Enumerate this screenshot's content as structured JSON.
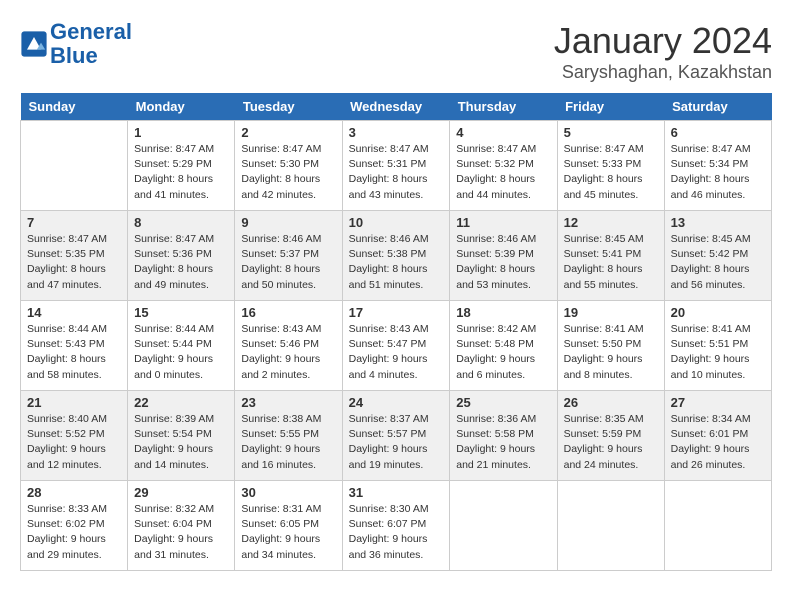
{
  "header": {
    "logo_line1": "General",
    "logo_line2": "Blue",
    "month": "January 2024",
    "location": "Saryshaghan, Kazakhstan"
  },
  "weekdays": [
    "Sunday",
    "Monday",
    "Tuesday",
    "Wednesday",
    "Thursday",
    "Friday",
    "Saturday"
  ],
  "weeks": [
    [
      {
        "day": "",
        "sunrise": "",
        "sunset": "",
        "daylight": ""
      },
      {
        "day": "1",
        "sunrise": "Sunrise: 8:47 AM",
        "sunset": "Sunset: 5:29 PM",
        "daylight": "Daylight: 8 hours and 41 minutes."
      },
      {
        "day": "2",
        "sunrise": "Sunrise: 8:47 AM",
        "sunset": "Sunset: 5:30 PM",
        "daylight": "Daylight: 8 hours and 42 minutes."
      },
      {
        "day": "3",
        "sunrise": "Sunrise: 8:47 AM",
        "sunset": "Sunset: 5:31 PM",
        "daylight": "Daylight: 8 hours and 43 minutes."
      },
      {
        "day": "4",
        "sunrise": "Sunrise: 8:47 AM",
        "sunset": "Sunset: 5:32 PM",
        "daylight": "Daylight: 8 hours and 44 minutes."
      },
      {
        "day": "5",
        "sunrise": "Sunrise: 8:47 AM",
        "sunset": "Sunset: 5:33 PM",
        "daylight": "Daylight: 8 hours and 45 minutes."
      },
      {
        "day": "6",
        "sunrise": "Sunrise: 8:47 AM",
        "sunset": "Sunset: 5:34 PM",
        "daylight": "Daylight: 8 hours and 46 minutes."
      }
    ],
    [
      {
        "day": "7",
        "sunrise": "Sunrise: 8:47 AM",
        "sunset": "Sunset: 5:35 PM",
        "daylight": "Daylight: 8 hours and 47 minutes."
      },
      {
        "day": "8",
        "sunrise": "Sunrise: 8:47 AM",
        "sunset": "Sunset: 5:36 PM",
        "daylight": "Daylight: 8 hours and 49 minutes."
      },
      {
        "day": "9",
        "sunrise": "Sunrise: 8:46 AM",
        "sunset": "Sunset: 5:37 PM",
        "daylight": "Daylight: 8 hours and 50 minutes."
      },
      {
        "day": "10",
        "sunrise": "Sunrise: 8:46 AM",
        "sunset": "Sunset: 5:38 PM",
        "daylight": "Daylight: 8 hours and 51 minutes."
      },
      {
        "day": "11",
        "sunrise": "Sunrise: 8:46 AM",
        "sunset": "Sunset: 5:39 PM",
        "daylight": "Daylight: 8 hours and 53 minutes."
      },
      {
        "day": "12",
        "sunrise": "Sunrise: 8:45 AM",
        "sunset": "Sunset: 5:41 PM",
        "daylight": "Daylight: 8 hours and 55 minutes."
      },
      {
        "day": "13",
        "sunrise": "Sunrise: 8:45 AM",
        "sunset": "Sunset: 5:42 PM",
        "daylight": "Daylight: 8 hours and 56 minutes."
      }
    ],
    [
      {
        "day": "14",
        "sunrise": "Sunrise: 8:44 AM",
        "sunset": "Sunset: 5:43 PM",
        "daylight": "Daylight: 8 hours and 58 minutes."
      },
      {
        "day": "15",
        "sunrise": "Sunrise: 8:44 AM",
        "sunset": "Sunset: 5:44 PM",
        "daylight": "Daylight: 9 hours and 0 minutes."
      },
      {
        "day": "16",
        "sunrise": "Sunrise: 8:43 AM",
        "sunset": "Sunset: 5:46 PM",
        "daylight": "Daylight: 9 hours and 2 minutes."
      },
      {
        "day": "17",
        "sunrise": "Sunrise: 8:43 AM",
        "sunset": "Sunset: 5:47 PM",
        "daylight": "Daylight: 9 hours and 4 minutes."
      },
      {
        "day": "18",
        "sunrise": "Sunrise: 8:42 AM",
        "sunset": "Sunset: 5:48 PM",
        "daylight": "Daylight: 9 hours and 6 minutes."
      },
      {
        "day": "19",
        "sunrise": "Sunrise: 8:41 AM",
        "sunset": "Sunset: 5:50 PM",
        "daylight": "Daylight: 9 hours and 8 minutes."
      },
      {
        "day": "20",
        "sunrise": "Sunrise: 8:41 AM",
        "sunset": "Sunset: 5:51 PM",
        "daylight": "Daylight: 9 hours and 10 minutes."
      }
    ],
    [
      {
        "day": "21",
        "sunrise": "Sunrise: 8:40 AM",
        "sunset": "Sunset: 5:52 PM",
        "daylight": "Daylight: 9 hours and 12 minutes."
      },
      {
        "day": "22",
        "sunrise": "Sunrise: 8:39 AM",
        "sunset": "Sunset: 5:54 PM",
        "daylight": "Daylight: 9 hours and 14 minutes."
      },
      {
        "day": "23",
        "sunrise": "Sunrise: 8:38 AM",
        "sunset": "Sunset: 5:55 PM",
        "daylight": "Daylight: 9 hours and 16 minutes."
      },
      {
        "day": "24",
        "sunrise": "Sunrise: 8:37 AM",
        "sunset": "Sunset: 5:57 PM",
        "daylight": "Daylight: 9 hours and 19 minutes."
      },
      {
        "day": "25",
        "sunrise": "Sunrise: 8:36 AM",
        "sunset": "Sunset: 5:58 PM",
        "daylight": "Daylight: 9 hours and 21 minutes."
      },
      {
        "day": "26",
        "sunrise": "Sunrise: 8:35 AM",
        "sunset": "Sunset: 5:59 PM",
        "daylight": "Daylight: 9 hours and 24 minutes."
      },
      {
        "day": "27",
        "sunrise": "Sunrise: 8:34 AM",
        "sunset": "Sunset: 6:01 PM",
        "daylight": "Daylight: 9 hours and 26 minutes."
      }
    ],
    [
      {
        "day": "28",
        "sunrise": "Sunrise: 8:33 AM",
        "sunset": "Sunset: 6:02 PM",
        "daylight": "Daylight: 9 hours and 29 minutes."
      },
      {
        "day": "29",
        "sunrise": "Sunrise: 8:32 AM",
        "sunset": "Sunset: 6:04 PM",
        "daylight": "Daylight: 9 hours and 31 minutes."
      },
      {
        "day": "30",
        "sunrise": "Sunrise: 8:31 AM",
        "sunset": "Sunset: 6:05 PM",
        "daylight": "Daylight: 9 hours and 34 minutes."
      },
      {
        "day": "31",
        "sunrise": "Sunrise: 8:30 AM",
        "sunset": "Sunset: 6:07 PM",
        "daylight": "Daylight: 9 hours and 36 minutes."
      },
      {
        "day": "",
        "sunrise": "",
        "sunset": "",
        "daylight": ""
      },
      {
        "day": "",
        "sunrise": "",
        "sunset": "",
        "daylight": ""
      },
      {
        "day": "",
        "sunrise": "",
        "sunset": "",
        "daylight": ""
      }
    ]
  ]
}
